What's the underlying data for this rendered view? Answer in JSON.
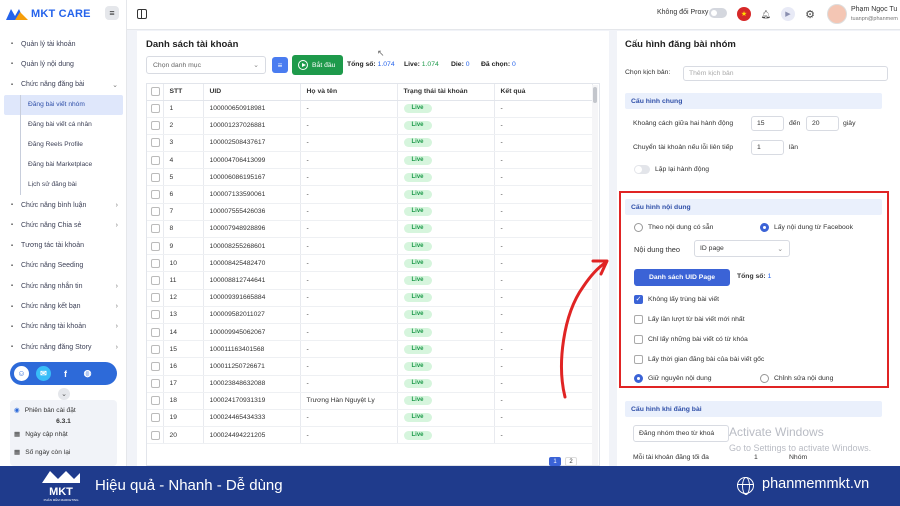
{
  "brand": {
    "logo_text": "MKT CARE"
  },
  "sidebar": {
    "items": [
      {
        "label": "Quản lý tài khoản",
        "icon": "accounts-icon",
        "chevron": false
      },
      {
        "label": "Quản lý nội dung",
        "icon": "content-icon",
        "chevron": false
      },
      {
        "label": "Chức năng đăng bài",
        "icon": "post-icon",
        "chevron": true,
        "expanded": true
      }
    ],
    "subitems": [
      {
        "label": "Đăng bài viết nhóm",
        "active": true
      },
      {
        "label": "Đăng bài viết cá nhân",
        "active": false
      },
      {
        "label": "Đăng Reels Profile",
        "active": false
      },
      {
        "label": "Đăng bài Marketplace",
        "active": false
      },
      {
        "label": "Lịch sử đăng bài",
        "active": false
      }
    ],
    "items2": [
      {
        "label": "Chức năng bình luận",
        "chevron": true
      },
      {
        "label": "Chức năng Chia sẻ",
        "chevron": true
      },
      {
        "label": "Tương tác tài khoản",
        "chevron": false
      },
      {
        "label": "Chức năng Seeding",
        "chevron": false
      },
      {
        "label": "Chức năng nhắn tin",
        "chevron": true
      },
      {
        "label": "Chức năng kết bạn",
        "chevron": true
      },
      {
        "label": "Chức năng tài khoản",
        "chevron": true
      },
      {
        "label": "Chức năng đăng Story",
        "chevron": true
      }
    ],
    "version_label": "Phiên bản cài đặt",
    "version_value": "6.3.1",
    "update_label": "Ngày cập nhật",
    "days_left_label": "Số ngày còn lại"
  },
  "topbar": {
    "proxy_label": "Không đổi Proxy",
    "user_name": "Phạm Ngọc Tu",
    "user_email": "tuanpn@phanmem"
  },
  "main": {
    "title": "Danh sách tài khoản",
    "category_placeholder": "Chọn danh mục",
    "start_label": "Bắt đầu",
    "stats": {
      "total_label": "Tổng số:",
      "total_value": "1.074",
      "live_label": "Live:",
      "live_value": "1.074",
      "die_label": "Die:",
      "die_value": "0",
      "selected_label": "Đã chọn:",
      "selected_value": "0"
    },
    "columns": [
      "STT",
      "UID",
      "Họ và tên",
      "Trạng thái tài khoản",
      "Kết quả"
    ],
    "rows": [
      {
        "stt": "1",
        "uid": "100000650918981",
        "name": "-",
        "status": "Live",
        "result": "-"
      },
      {
        "stt": "2",
        "uid": "100001237026881",
        "name": "-",
        "status": "Live",
        "result": "-"
      },
      {
        "stt": "3",
        "uid": "100002508437617",
        "name": "-",
        "status": "Live",
        "result": "-"
      },
      {
        "stt": "4",
        "uid": "100004706413099",
        "name": "-",
        "status": "Live",
        "result": "-"
      },
      {
        "stt": "5",
        "uid": "100006086195167",
        "name": "-",
        "status": "Live",
        "result": "-"
      },
      {
        "stt": "6",
        "uid": "100007133590061",
        "name": "-",
        "status": "Live",
        "result": "-"
      },
      {
        "stt": "7",
        "uid": "100007555426036",
        "name": "-",
        "status": "Live",
        "result": "-"
      },
      {
        "stt": "8",
        "uid": "100007948928896",
        "name": "-",
        "status": "Live",
        "result": "-"
      },
      {
        "stt": "9",
        "uid": "100008255268601",
        "name": "-",
        "status": "Live",
        "result": "-"
      },
      {
        "stt": "10",
        "uid": "100008425482470",
        "name": "-",
        "status": "Live",
        "result": "-"
      },
      {
        "stt": "11",
        "uid": "100008812744641",
        "name": "-",
        "status": "Live",
        "result": "-"
      },
      {
        "stt": "12",
        "uid": "100009391665884",
        "name": "-",
        "status": "Live",
        "result": "-"
      },
      {
        "stt": "13",
        "uid": "100009582011027",
        "name": "-",
        "status": "Live",
        "result": "-"
      },
      {
        "stt": "14",
        "uid": "100009945062067",
        "name": "-",
        "status": "Live",
        "result": "-"
      },
      {
        "stt": "15",
        "uid": "100011163401568",
        "name": "-",
        "status": "Live",
        "result": "-"
      },
      {
        "stt": "16",
        "uid": "100011250726671",
        "name": "-",
        "status": "Live",
        "result": "-"
      },
      {
        "stt": "17",
        "uid": "100023848632088",
        "name": "-",
        "status": "Live",
        "result": "-"
      },
      {
        "stt": "18",
        "uid": "100024170931319",
        "name": "Trương Hàn Nguyệt Ly",
        "status": "Live",
        "result": "-"
      },
      {
        "stt": "19",
        "uid": "100024465434333",
        "name": "-",
        "status": "Live",
        "result": "-"
      },
      {
        "stt": "20",
        "uid": "100024494221205",
        "name": "-",
        "status": "Live",
        "result": "-"
      }
    ],
    "pagination": {
      "current": "1",
      "next": "2"
    }
  },
  "config": {
    "title": "Cấu hình đăng bài nhóm",
    "scenario_label": "Chọn kịch bản:",
    "scenario_placeholder": "Thêm kịch bản",
    "general": {
      "title": "Cấu hình chung",
      "interval_label": "Khoảng cách giữa hai hành động",
      "interval_from": "15",
      "interval_to_label": "đến",
      "interval_to": "20",
      "interval_unit": "giây",
      "switch_label": "Chuyển tài khoản nếu lỗi liên tiếp",
      "switch_value": "1",
      "switch_unit": "lần",
      "repeat_label": "Lặp lại hành động"
    },
    "content": {
      "title": "Cấu hình nội dung",
      "option_existing": "Theo nội dung có sẵn",
      "option_facebook": "Lấy nội dung từ Facebook",
      "content_by_label": "Nội dung theo",
      "content_by_value": "ID page",
      "uid_button": "Danh sách UID Page",
      "total_label": "Tổng số:",
      "total_value": "1",
      "checks": [
        {
          "label": "Không lấy trùng bài viết",
          "checked": true
        },
        {
          "label": "Lấy lần lượt từ bài viết mới nhất",
          "checked": false
        },
        {
          "label": "Chỉ lấy những bài viết có từ khóa",
          "checked": false
        },
        {
          "label": "Lấy thời gian đăng bài của bài viết gốc",
          "checked": false
        }
      ],
      "keep_label": "Giữ nguyên nội dung",
      "edit_label": "Chỉnh sửa nội dung"
    },
    "posting": {
      "title": "Cấu hình khi đăng bài",
      "group_select": "Đăng nhóm theo từ khoá",
      "per_account_label": "Mỗi tài khoản đăng tối đa",
      "per_account_value": "1",
      "per_account_unit": "Nhóm"
    }
  },
  "watermark": {
    "line1": "Activate Windows",
    "line2": "Go to Settings to activate Windows."
  },
  "footer": {
    "slogan": "Hiệu quả - Nhanh - Dễ dùng",
    "site": "phanmemmkt.vn",
    "logo_text": "MKT",
    "logo_subtext": "PHẦN MỀM MARKETING"
  },
  "colors": {
    "primary": "#3b63d6",
    "success": "#1e9a4b",
    "highlight": "#e02424",
    "footer": "#1f3b8c"
  }
}
